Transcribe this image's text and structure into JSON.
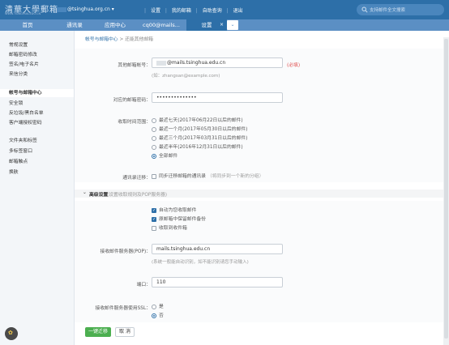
{
  "header": {
    "logo_text": "清華大學郵箱",
    "logo_subtext": "WWW.TSINGHUA.EDU.CN",
    "user_email": "@tsinghua.org.cn",
    "links": [
      "设置",
      "我的邮箱",
      "自助查询",
      "退出"
    ],
    "search_placeholder": "支持邮件全文搜索"
  },
  "tabs": [
    {
      "label": "首页"
    },
    {
      "label": "通讯录"
    },
    {
      "label": "应用中心"
    },
    {
      "label": "cq00@mails..."
    },
    {
      "label": "设置"
    }
  ],
  "sidebar": {
    "items": [
      {
        "label": "常规设置"
      },
      {
        "label": "邮箱密码修改"
      },
      {
        "label": "签名/电子名片"
      },
      {
        "label": "来信分类"
      },
      {
        "label": "帐号与邮箱中心"
      },
      {
        "label": "安全锁"
      },
      {
        "label": "反垃圾/黑白名单"
      },
      {
        "label": "客户端授权密码"
      },
      {
        "label": "文件夹和标签"
      },
      {
        "label": "多标签窗口"
      },
      {
        "label": "邮箱触点"
      },
      {
        "label": "换肤"
      }
    ]
  },
  "breadcrumb": {
    "parent": "帐号与邮箱中心",
    "sep": ">",
    "current": "还能其他邮箱"
  },
  "form": {
    "account_label": "其他邮箱帐号：",
    "account_value": "@mails.tsinghua.edu.cn",
    "account_required": "(必填)",
    "account_hint": "(如：zhangsan@example.com)",
    "password_label": "对应的邮箱密码：",
    "password_value": "••••••••••••••",
    "range_label": "收取时间范围：",
    "range_options": [
      "最近七天(2017年06月22日以后的邮件)",
      "最近一个月(2017年05月30日以后的邮件)",
      "最近三个月(2017年03月31日以后的邮件)",
      "最近半年(2016年12月31日以后的邮件)",
      "全部邮件"
    ],
    "range_selected": 4,
    "contacts_label": "通讯录迁移：",
    "contacts_option": "同步迁移邮箱的通讯录",
    "contacts_hint": "（将同步到一个新的分组）",
    "advanced_toggle": "高级设置",
    "advanced_hint": "(设置收取规则及POP服务器)",
    "adv_checks": [
      {
        "label": "自动为您收取邮件",
        "checked": true
      },
      {
        "label": "原邮箱中保留邮件备份",
        "checked": true
      },
      {
        "label": "收取到收件箱",
        "checked": false
      }
    ],
    "pop_label": "接收邮件服务器(POP)：",
    "pop_value": "mails.tsinghua.edu.cn",
    "pop_hint": "(系统一般能自动识别，如不能识别请您手动输入)",
    "port_label": "端口：",
    "port_value": "110",
    "ssl_label": "接收邮件服务器使用SSL：",
    "ssl_options": [
      "是",
      "否"
    ],
    "ssl_selected": 1,
    "submit_label": "一键迁移",
    "cancel_label": "取 消"
  },
  "icons": {
    "search": "search-icon",
    "app_center": "app-center-icon"
  },
  "colors": {
    "header_bg": "#2d6fa8",
    "tabbar_bg": "#5b8fc4",
    "primary_button": "#4caf50",
    "required_text": "#e05050"
  }
}
